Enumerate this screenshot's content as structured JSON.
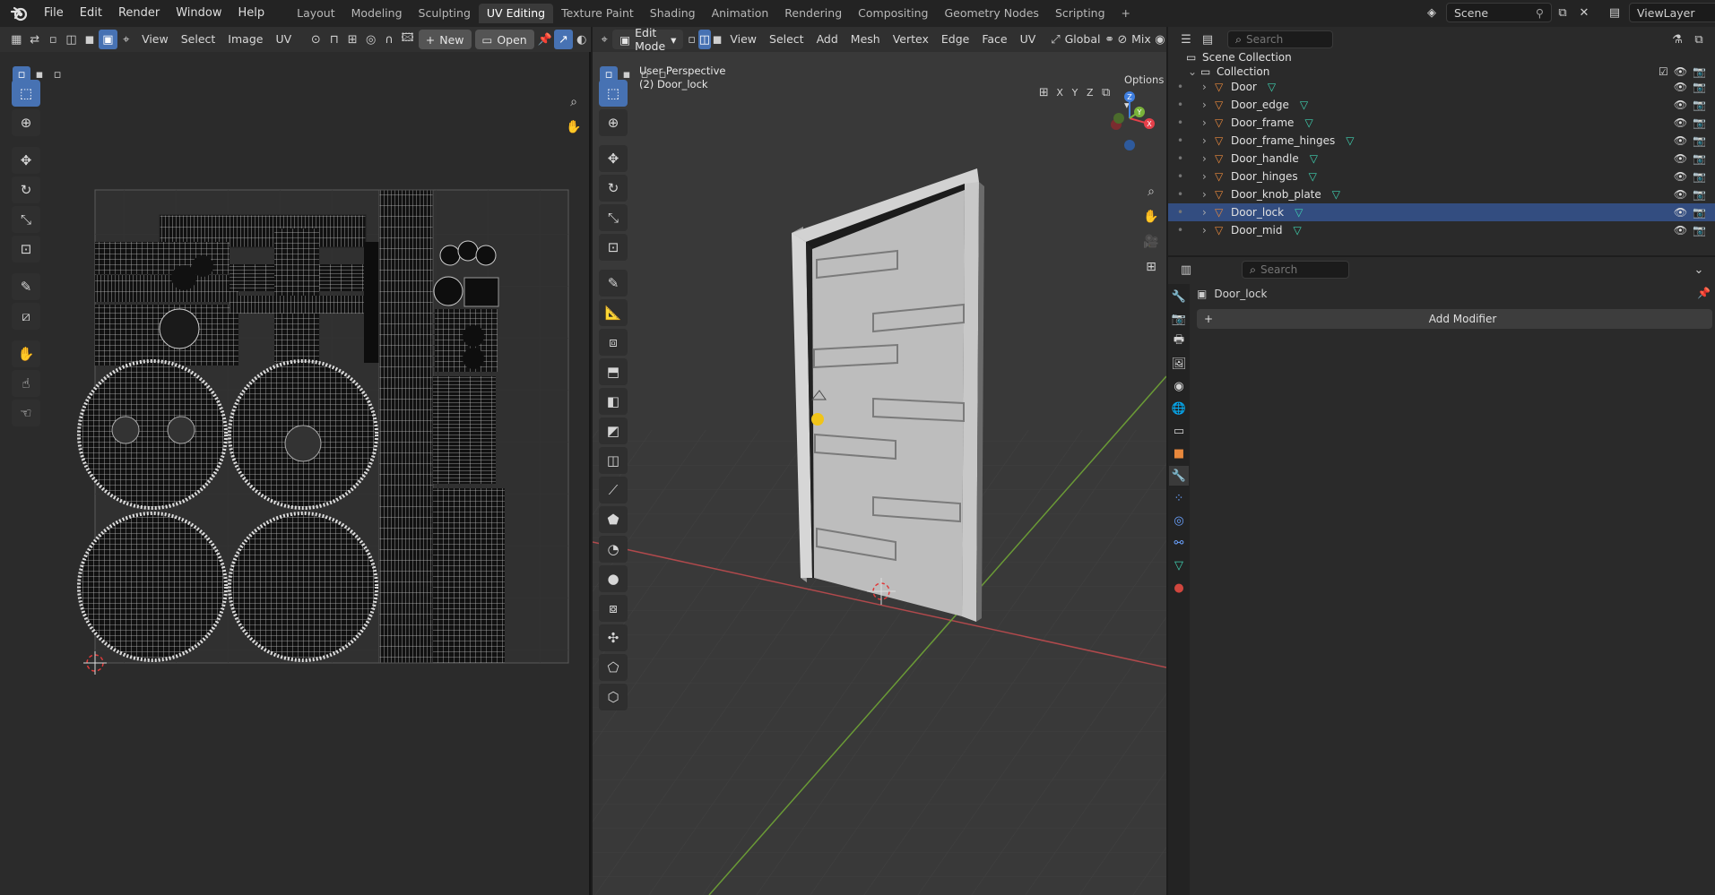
{
  "topbar": {
    "menus": [
      "File",
      "Edit",
      "Render",
      "Window",
      "Help"
    ],
    "workspaces": [
      "Layout",
      "Modeling",
      "Sculpting",
      "UV Editing",
      "Texture Paint",
      "Shading",
      "Animation",
      "Rendering",
      "Compositing",
      "Geometry Nodes",
      "Scripting"
    ],
    "active_workspace": "UV Editing",
    "add_tab": "+",
    "scene": "Scene",
    "view_layer": "ViewLayer"
  },
  "uv_header": {
    "menus": [
      "View",
      "Select",
      "Image",
      "UV"
    ],
    "new_label": "New",
    "open_label": "Open"
  },
  "viewport_header": {
    "mode": "Edit Mode",
    "menus": [
      "View",
      "Select",
      "Add",
      "Mesh",
      "Vertex",
      "Edge",
      "Face",
      "UV"
    ],
    "orientation": "Global",
    "shading": "Mix",
    "options_label": "Options",
    "axes": [
      "X",
      "Y",
      "Z"
    ]
  },
  "viewport": {
    "perspective": "User Perspective",
    "object_info": "(2) Door_lock"
  },
  "gizmo": {
    "x": "X",
    "y": "Y",
    "z": "Z"
  },
  "outliner": {
    "search_placeholder": "Search",
    "scene_collection": "Scene Collection",
    "collection": "Collection",
    "items": [
      {
        "name": "Door",
        "selected": false
      },
      {
        "name": "Door_edge",
        "selected": false
      },
      {
        "name": "Door_frame",
        "selected": false
      },
      {
        "name": "Door_frame_hinges",
        "selected": false
      },
      {
        "name": "Door_handle",
        "selected": false
      },
      {
        "name": "Door_hinges",
        "selected": false
      },
      {
        "name": "Door_knob_plate",
        "selected": false
      },
      {
        "name": "Door_lock",
        "selected": true
      },
      {
        "name": "Door_mid",
        "selected": false
      }
    ]
  },
  "properties": {
    "search_placeholder": "Search",
    "object_name": "Door_lock",
    "add_modifier": "Add Modifier"
  },
  "colors": {
    "accent": "#4772b3",
    "selected_row": "#334d80",
    "axis_x": "#e5404a",
    "axis_y": "#7ab33a",
    "axis_z": "#3f7fe0",
    "object_icon": "#e8883c",
    "mesh_icon": "#3fd0b0"
  }
}
